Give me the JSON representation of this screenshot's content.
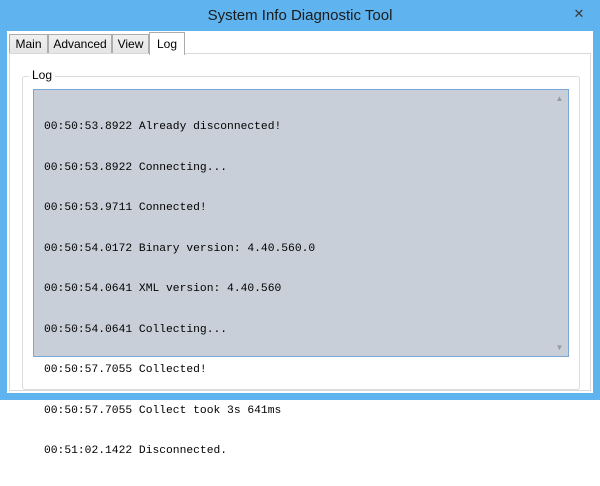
{
  "window": {
    "title": "System Info Diagnostic Tool",
    "close_glyph": "✕"
  },
  "tabs": [
    {
      "label": "Main"
    },
    {
      "label": "Advanced"
    },
    {
      "label": "View"
    },
    {
      "label": "Log"
    }
  ],
  "active_tab": "Log",
  "log_panel": {
    "group_label": "Log",
    "lines": [
      "00:50:53.8922 Already disconnected!",
      "00:50:53.8922 Connecting...",
      "00:50:53.9711 Connected!",
      "00:50:54.0172 Binary version: 4.40.560.0",
      "00:50:54.0641 XML version: 4.40.560",
      "00:50:54.0641 Collecting...",
      "00:50:57.7055 Collected!",
      "00:50:57.7055 Collect took 3s 641ms",
      "00:51:02.1422 Disconnected."
    ],
    "scroll_up_glyph": "▲",
    "scroll_down_glyph": "▼"
  }
}
